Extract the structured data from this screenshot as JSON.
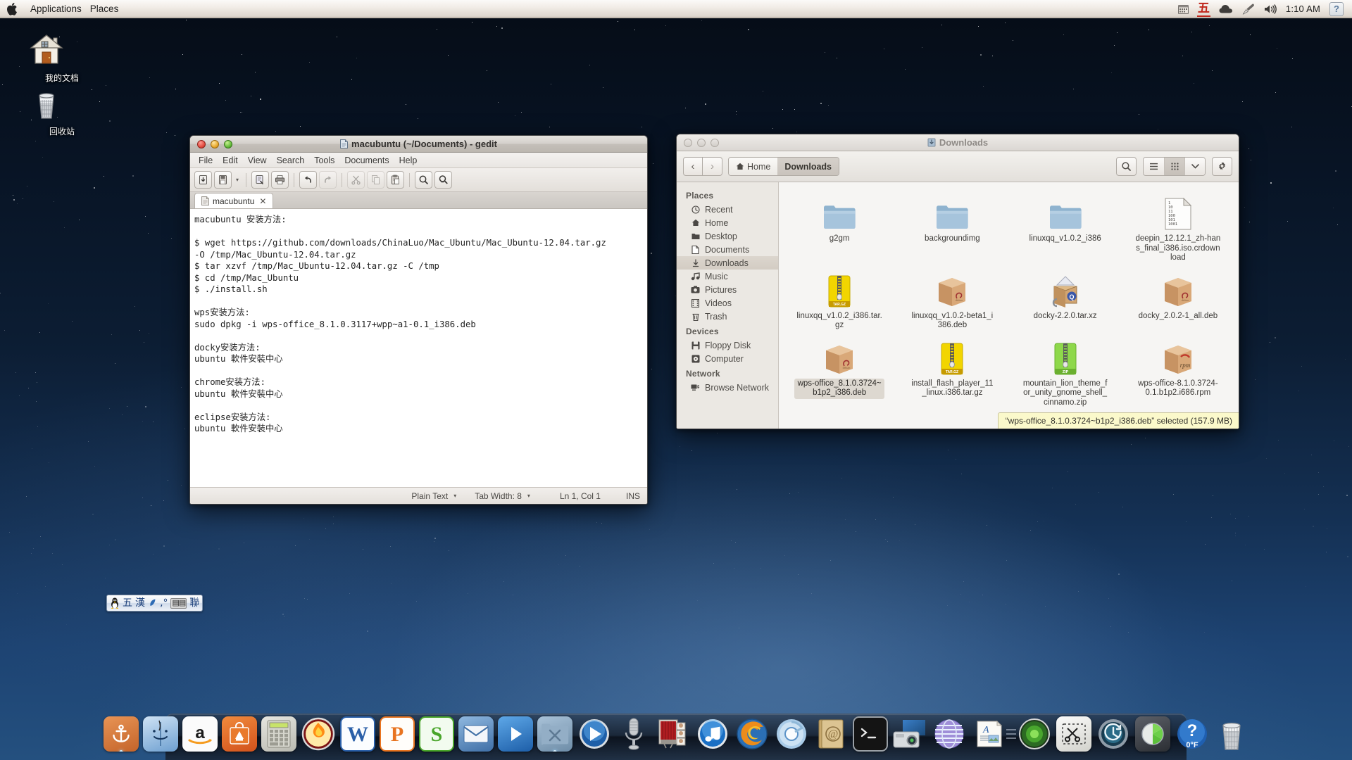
{
  "menubar": {
    "apple_icon": "apple-logo-icon",
    "items": [
      "Applications",
      "Places"
    ],
    "right": {
      "calendar_icon": "calendar-icon",
      "ime_indicator": "五",
      "cloud_icon": "cloud-icon",
      "brush_icon": "brush-icon",
      "volume_icon": "speaker-icon",
      "clock": "1:10 AM",
      "help_label": "?"
    }
  },
  "desktop": {
    "icons": [
      {
        "name": "我的文档",
        "icon": "home-house-icon"
      },
      {
        "name": "回收站",
        "icon": "trash-bin-icon"
      }
    ]
  },
  "gedit": {
    "title": "macubuntu (~/Documents) - gedit",
    "title_icon": "text-file-icon",
    "menu": [
      "File",
      "Edit",
      "View",
      "Search",
      "Tools",
      "Documents",
      "Help"
    ],
    "toolbar": [
      {
        "name": "open-button",
        "icon": "open-folder-icon",
        "disabled": false
      },
      {
        "name": "save-button",
        "icon": "save-disk-icon",
        "disabled": false
      },
      {
        "name": "save-dropdown",
        "icon": "chevron-down-icon",
        "disabled": false
      },
      {
        "name": "print-preview-button",
        "icon": "print-preview-icon",
        "disabled": false
      },
      {
        "name": "print-button",
        "icon": "printer-icon",
        "disabled": false
      },
      {
        "name": "undo-button",
        "icon": "undo-arrow-icon",
        "disabled": false
      },
      {
        "name": "redo-button",
        "icon": "redo-arrow-icon",
        "disabled": true
      },
      {
        "name": "cut-button",
        "icon": "scissors-icon",
        "disabled": true
      },
      {
        "name": "copy-button",
        "icon": "copy-icon",
        "disabled": true
      },
      {
        "name": "paste-button",
        "icon": "clipboard-paste-icon",
        "disabled": false
      },
      {
        "name": "find-button",
        "icon": "magnifier-icon",
        "disabled": false
      },
      {
        "name": "replace-button",
        "icon": "magnifier-replace-icon",
        "disabled": false
      }
    ],
    "tab": {
      "label": "macubuntu",
      "close": "✕",
      "icon": "document-icon"
    },
    "content": "macubuntu 安装方法:\n\n$ wget https://github.com/downloads/ChinaLuo/Mac_Ubuntu/Mac_Ubuntu-12.04.tar.gz\n-O /tmp/Mac_Ubuntu-12.04.tar.gz\n$ tar xzvf /tmp/Mac_Ubuntu-12.04.tar.gz -C /tmp\n$ cd /tmp/Mac_Ubuntu\n$ ./install.sh\n\nwps安装方法:\nsudo dpkg -i wps-office_8.1.0.3117+wpp~a1-0.1_i386.deb\n\ndocky安装方法:\nubuntu 軟件安裝中心\n\nchrome安装方法:\nubuntu 軟件安裝中心\n\neclipse安装方法:\nubuntu 軟件安裝中心",
    "status": {
      "language": "Plain Text",
      "tab_width": "Tab Width: 8",
      "position": "Ln 1, Col 1",
      "insert_mode": "INS"
    }
  },
  "nautilus": {
    "title": "Downloads",
    "title_icon": "downloads-folder-icon",
    "nav": {
      "back": "‹",
      "forward": "›"
    },
    "breadcrumbs": [
      {
        "label": "Home",
        "icon": "home-icon",
        "active": false
      },
      {
        "label": "Downloads",
        "icon": "",
        "active": true
      }
    ],
    "toolbar_right": {
      "search_icon": "search-magnifier-icon",
      "list_view_icon": "list-view-icon",
      "grid_view_icon": "grid-view-icon",
      "view_dropdown_icon": "chevron-down-icon",
      "settings_icon": "gear-icon"
    },
    "sidebar": [
      {
        "heading": "Places",
        "items": [
          {
            "label": "Recent",
            "icon": "clock-recent-icon",
            "selected": false
          },
          {
            "label": "Home",
            "icon": "home-icon",
            "selected": false
          },
          {
            "label": "Desktop",
            "icon": "desktop-folder-icon",
            "selected": false
          },
          {
            "label": "Documents",
            "icon": "document-page-icon",
            "selected": false
          },
          {
            "label": "Downloads",
            "icon": "download-arrow-icon",
            "selected": true
          },
          {
            "label": "Music",
            "icon": "music-note-icon",
            "selected": false
          },
          {
            "label": "Pictures",
            "icon": "camera-icon",
            "selected": false
          },
          {
            "label": "Videos",
            "icon": "film-strip-icon",
            "selected": false
          },
          {
            "label": "Trash",
            "icon": "trash-icon",
            "selected": false
          }
        ]
      },
      {
        "heading": "Devices",
        "items": [
          {
            "label": "Floppy Disk",
            "icon": "floppy-disk-icon",
            "selected": false
          },
          {
            "label": "Computer",
            "icon": "computer-disk-icon",
            "selected": false
          }
        ]
      },
      {
        "heading": "Network",
        "items": [
          {
            "label": "Browse Network",
            "icon": "network-icon",
            "selected": false
          }
        ]
      }
    ],
    "files": [
      {
        "name": "g2gm",
        "type": "folder",
        "selected": false
      },
      {
        "name": "backgroundimg",
        "type": "folder",
        "selected": false
      },
      {
        "name": "linuxqq_v1.0.2_i386",
        "type": "folder",
        "selected": false
      },
      {
        "name": "deepin_12.12.1_zh-hans_final_i386.iso.crdownload",
        "type": "binary",
        "selected": false
      },
      {
        "name": "linuxqq_v1.0.2_i386.tar.gz",
        "type": "targz",
        "selected": false
      },
      {
        "name": "linuxqq_v1.0.2-beta1_i386.deb",
        "type": "deb",
        "selected": false
      },
      {
        "name": "docky-2.2.0.tar.xz",
        "type": "archive-open",
        "selected": false
      },
      {
        "name": "docky_2.0.2-1_all.deb",
        "type": "deb",
        "selected": false
      },
      {
        "name": "wps-office_8.1.0.3724~b1p2_i386.deb",
        "type": "deb",
        "selected": true
      },
      {
        "name": "install_flash_player_11_linux.i386.tar.gz",
        "type": "targz",
        "selected": false
      },
      {
        "name": "mountain_lion_theme_for_unity_gnome_shell_cinnamo.zip",
        "type": "zip",
        "selected": false
      },
      {
        "name": "wps-office-8.1.0.3724-0.1.b1p2.i686.rpm",
        "type": "rpm",
        "selected": false
      }
    ],
    "status": "“wps-office_8.1.0.3724~b1p2_i386.deb” selected (157.9 MB)"
  },
  "ime_bar": {
    "items": [
      {
        "name": "linux-penguin-icon",
        "glyph": "🐧"
      },
      {
        "name": "ime-mode-wu",
        "glyph": "五"
      },
      {
        "name": "ime-mode-han",
        "glyph": "漢"
      },
      {
        "name": "half-width-moon-icon",
        "glyph": "☽"
      },
      {
        "name": "punctuation-icon",
        "glyph": "‚°"
      },
      {
        "name": "virtual-keyboard-icon",
        "glyph": "⌨"
      },
      {
        "name": "ime-lian",
        "glyph": "聯"
      }
    ]
  },
  "dock": {
    "items": [
      {
        "name": "docky-anchor",
        "icon": "anchor-icon",
        "running": true
      },
      {
        "name": "finder",
        "icon": "finder-face-icon",
        "running": false
      },
      {
        "name": "amazon",
        "icon": "amazon-a-icon",
        "running": false
      },
      {
        "name": "ubuntu-software-center",
        "icon": "software-bag-icon",
        "running": false
      },
      {
        "name": "calculator",
        "icon": "calculator-icon",
        "running": false
      },
      {
        "name": "brasero-burn",
        "icon": "disc-burn-icon",
        "running": false
      },
      {
        "name": "wps-writer",
        "icon": "w-letter-icon",
        "running": false
      },
      {
        "name": "wps-presentation",
        "icon": "p-letter-icon",
        "running": false
      },
      {
        "name": "wps-spreadsheet",
        "icon": "s-letter-icon",
        "running": false
      },
      {
        "name": "mail",
        "icon": "envelope-icon",
        "running": false
      },
      {
        "name": "media-player",
        "icon": "play-button-icon",
        "running": false
      },
      {
        "name": "system-tools-folder",
        "icon": "tools-folder-icon",
        "running": true
      },
      {
        "name": "quicktime-player",
        "icon": "play-circle-icon",
        "running": false
      },
      {
        "name": "sound-recorder",
        "icon": "microphone-icon",
        "running": false
      },
      {
        "name": "photo-booth",
        "icon": "photo-booth-icon",
        "running": false
      },
      {
        "name": "itunes",
        "icon": "music-note-circle-icon",
        "running": false
      },
      {
        "name": "firefox",
        "icon": "firefox-icon",
        "running": false
      },
      {
        "name": "chromium",
        "icon": "chromium-icon",
        "running": false
      },
      {
        "name": "address-book",
        "icon": "address-book-icon",
        "running": false
      },
      {
        "name": "terminal",
        "icon": "terminal-icon",
        "running": false
      },
      {
        "name": "screenshot-camera",
        "icon": "camera-screenshot-icon",
        "running": false
      },
      {
        "name": "globe-network",
        "icon": "globe-icon",
        "running": false
      },
      {
        "name": "font-book",
        "icon": "font-book-icon",
        "running": false
      },
      {
        "name": "separator",
        "icon": "dock-separator",
        "running": false
      },
      {
        "name": "green-orb",
        "icon": "green-orb-icon",
        "running": false
      },
      {
        "name": "screenshot-crop",
        "icon": "scissors-crop-icon",
        "running": false
      },
      {
        "name": "time-machine",
        "icon": "time-machine-icon",
        "running": false
      },
      {
        "name": "disk-usage",
        "icon": "pie-disk-icon",
        "running": false
      },
      {
        "name": "weather",
        "icon": "weather-question-icon",
        "running": false,
        "label": "0°F"
      },
      {
        "name": "trash",
        "icon": "trash-dock-icon",
        "running": false
      }
    ]
  }
}
